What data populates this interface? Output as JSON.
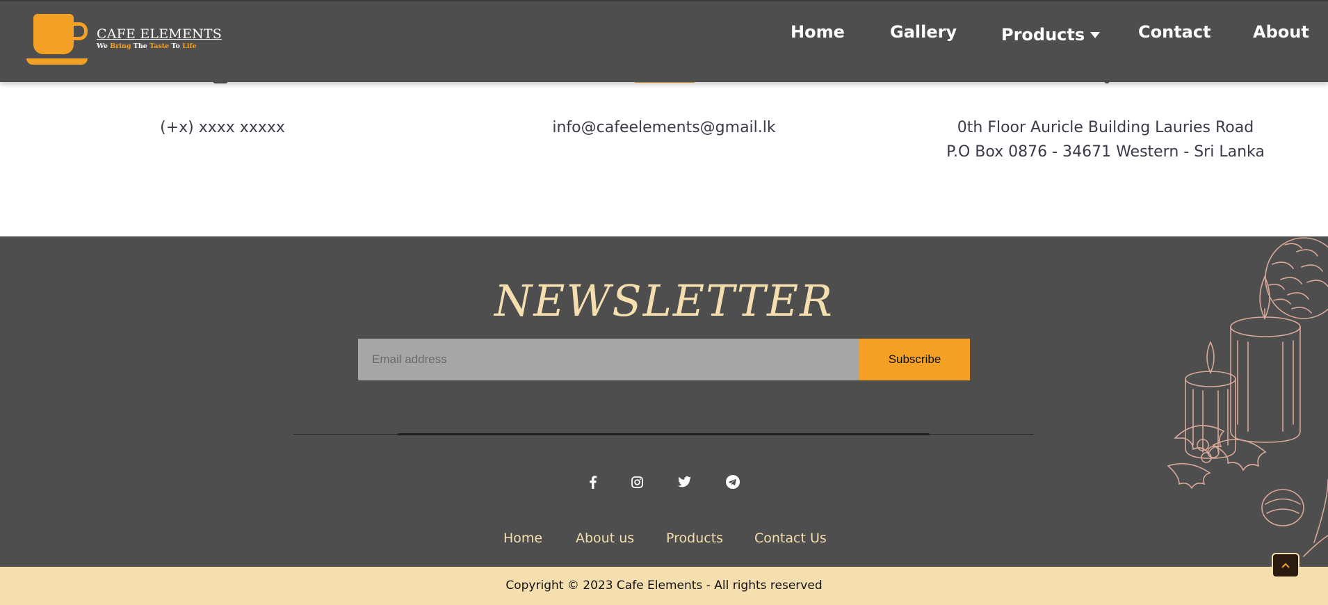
{
  "brand": {
    "name": "CAFE ELEMENTS",
    "tagline": {
      "w1": "We",
      "w2": "Bring",
      "w3": "The",
      "w4": "Taste",
      "w5": "To",
      "w6": "Life"
    },
    "accent_color": "#f4a025",
    "cream_color": "#f6dfae"
  },
  "nav": {
    "home": "Home",
    "gallery": "Gallery",
    "products": "Products",
    "contact": "Contact",
    "about": "About"
  },
  "contact": {
    "phone": "(+x) xxxx xxxxx",
    "email": "info@cafeelements@gmail.lk",
    "address_line1": "0th Floor Auricle Building Lauries Road",
    "address_line2": "P.O Box 0876 - 34671 Western - Sri Lanka"
  },
  "newsletter": {
    "title": "NEWSLETTER",
    "email_placeholder": "Email address",
    "subscribe_label": "Subscribe"
  },
  "social": {
    "icons": [
      "facebook-icon",
      "instagram-icon",
      "twitter-icon",
      "telegram-icon"
    ]
  },
  "footer_links": {
    "home": "Home",
    "about": "About us",
    "products": "Products",
    "contact": "Contact Us"
  },
  "copyright": "Copyright © 2023 Cafe Elements - All rights reserved"
}
